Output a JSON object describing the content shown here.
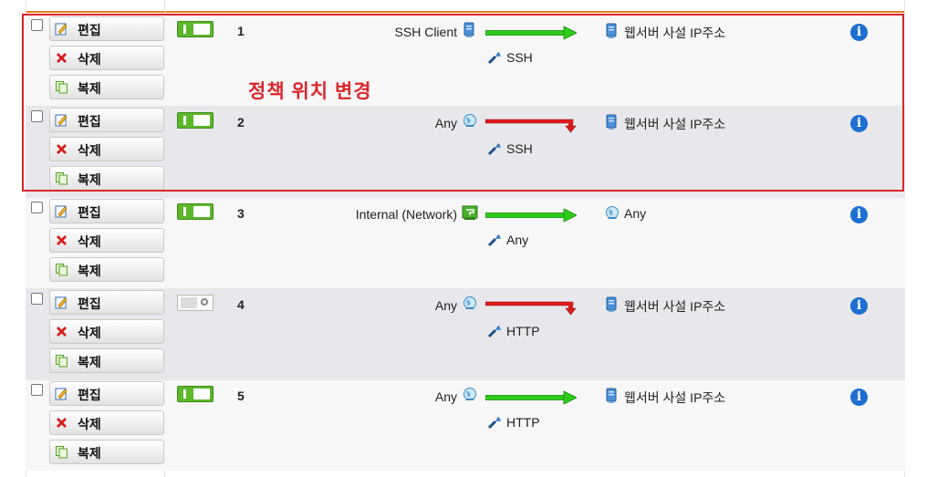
{
  "annotation": "정책 위치 변경",
  "colors": {
    "highlight": "#d9262c",
    "allow_arrow": "#2ecc1a",
    "deny_arrow": "#e01b1b",
    "toggle_on": "#5cb82a",
    "info": "#1e6fd1"
  },
  "buttons": {
    "edit": "편집",
    "delete": "삭제",
    "copy": "복제"
  },
  "rows": [
    {
      "number": "1",
      "enabled": true,
      "source": "SSH Client",
      "source_icon": "host-icon",
      "action": "allow",
      "service": "SSH",
      "destination": "웹서버 사설 IP주소",
      "destination_icon": "host-icon"
    },
    {
      "number": "2",
      "enabled": true,
      "source": "Any",
      "source_icon": "globe-icon",
      "action": "deny",
      "service": "SSH",
      "destination": "웹서버 사설 IP주소",
      "destination_icon": "host-icon"
    },
    {
      "number": "3",
      "enabled": true,
      "source": "Internal (Network)",
      "source_icon": "network-icon",
      "action": "allow",
      "service": "Any",
      "destination": "Any",
      "destination_icon": "globe-icon"
    },
    {
      "number": "4",
      "enabled": false,
      "source": "Any",
      "source_icon": "globe-icon",
      "action": "deny",
      "service": "HTTP",
      "destination": "웹서버 사설 IP주소",
      "destination_icon": "host-icon"
    },
    {
      "number": "5",
      "enabled": true,
      "source": "Any",
      "source_icon": "globe-icon",
      "action": "allow",
      "service": "HTTP",
      "destination": "웹서버 사설 IP주소",
      "destination_icon": "host-icon"
    }
  ]
}
